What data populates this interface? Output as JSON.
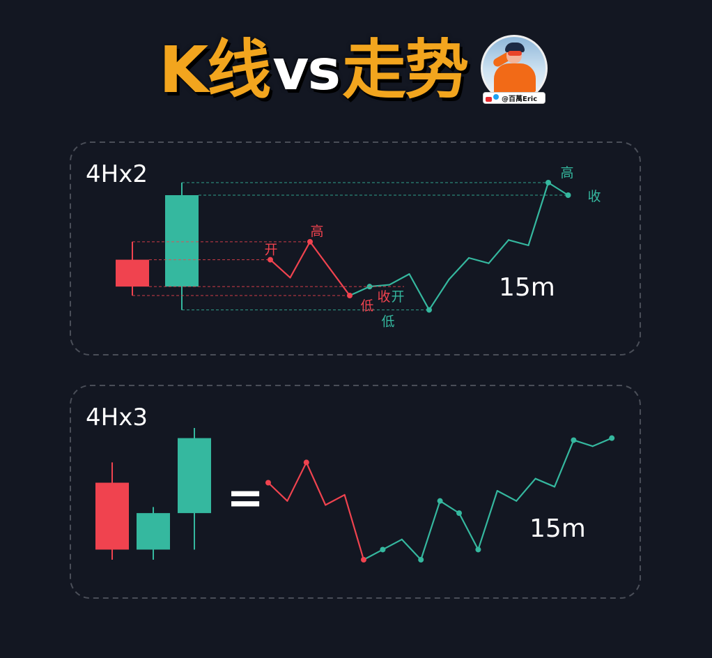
{
  "header": {
    "title_part1": "K线",
    "title_part2": "vs",
    "title_part3": "走势",
    "avatar_handle": "@百萬Eric"
  },
  "colors": {
    "background": "#131722",
    "bearish": "#f0434f",
    "bullish": "#35b89f",
    "title_accent": "#f2a51e",
    "panel_border": "#4a4e58"
  },
  "chart_data": [
    {
      "type": "candlestick-vs-line",
      "title": "4Hx2",
      "line_label": "15m",
      "candles": [
        {
          "open": 2.0,
          "high": 3.0,
          "low": 0.0,
          "close": 0.5,
          "color": "bearish"
        },
        {
          "open": 0.5,
          "high": 6.3,
          "low": -0.8,
          "close": 5.6,
          "color": "bullish"
        }
      ],
      "line": {
        "x": [
          0,
          1,
          2,
          3,
          4,
          5,
          6,
          7,
          8,
          9,
          10,
          11,
          12,
          13,
          14,
          15
        ],
        "y": [
          2.0,
          1.0,
          3.0,
          1.5,
          0.0,
          0.5,
          0.6,
          1.2,
          -0.8,
          0.9,
          2.1,
          1.8,
          3.1,
          2.8,
          6.3,
          5.6
        ],
        "colors": [
          "bearish",
          "bearish",
          "bearish",
          "bearish",
          "bearish",
          "bullish",
          "bullish",
          "bullish",
          "bullish",
          "bullish",
          "bullish",
          "bullish",
          "bullish",
          "bullish",
          "bullish",
          "bullish"
        ]
      },
      "annotations": [
        {
          "label": "开",
          "color": "bearish"
        },
        {
          "label": "高",
          "color": "bearish"
        },
        {
          "label": "低",
          "color": "bearish"
        },
        {
          "label": "收",
          "color": "bearish"
        },
        {
          "label": "开",
          "color": "bullish"
        },
        {
          "label": "低",
          "color": "bullish"
        },
        {
          "label": "高",
          "color": "bullish"
        },
        {
          "label": "收",
          "color": "bullish"
        }
      ]
    },
    {
      "type": "candlestick-vs-line",
      "title": "4Hx3",
      "equals_sign": "=",
      "line_label": "15m",
      "candles": [
        {
          "open": 3.8,
          "high": 4.8,
          "low": 0.0,
          "close": 0.5,
          "color": "bearish"
        },
        {
          "open": 0.5,
          "high": 2.6,
          "low": 0.0,
          "close": 2.3,
          "color": "bullish"
        },
        {
          "open": 2.3,
          "high": 6.5,
          "low": 0.5,
          "close": 6.0,
          "color": "bullish"
        }
      ],
      "line": {
        "x": [
          0,
          1,
          2,
          3,
          4,
          5,
          6,
          7,
          8,
          9,
          10,
          11,
          12,
          13,
          14,
          15,
          16,
          17,
          18
        ],
        "y": [
          3.8,
          2.9,
          4.8,
          2.7,
          3.2,
          0.0,
          0.5,
          1.0,
          0.0,
          2.9,
          2.3,
          0.5,
          3.4,
          2.9,
          4.0,
          3.6,
          5.9,
          5.6,
          6.0
        ],
        "colors": [
          "bearish",
          "bearish",
          "bearish",
          "bearish",
          "bearish",
          "bearish",
          "bullish",
          "bullish",
          "bullish",
          "bullish",
          "bullish",
          "bullish",
          "bullish",
          "bullish",
          "bullish",
          "bullish",
          "bullish",
          "bullish",
          "bullish"
        ]
      }
    }
  ]
}
